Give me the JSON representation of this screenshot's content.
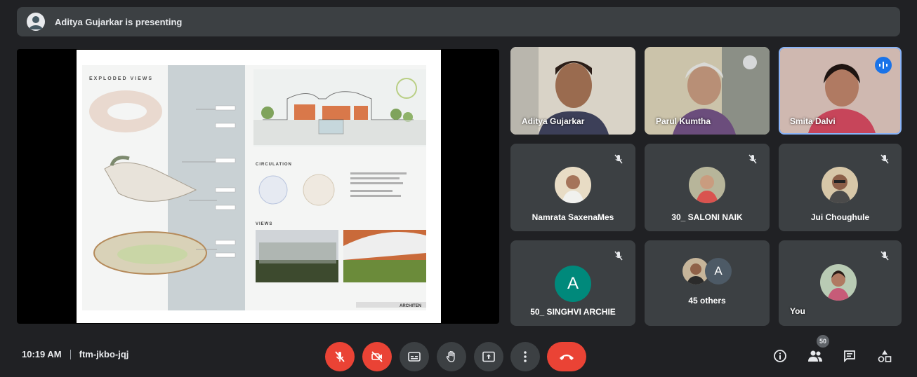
{
  "header": {
    "presenting_text": "Aditya Gujarkar is presenting"
  },
  "slide": {
    "title": "EXPLODED VIEWS",
    "section_circulation": "CIRCULATION",
    "section_views": "VIEWS",
    "brand": "ARCHITEN"
  },
  "participants": {
    "video": [
      {
        "name": "Aditya Gujarkar"
      },
      {
        "name": "Parul Kumtha"
      },
      {
        "name": "Smita Dalvi"
      }
    ],
    "avatar": [
      {
        "name": "Namrata SaxenaMes"
      },
      {
        "name": "30_ SALONI NAIK"
      },
      {
        "name": "Jui Choughule"
      },
      {
        "name": "50_ SINGHVI ARCHIE",
        "initial": "A"
      }
    ],
    "others": {
      "label": "45 others",
      "initial": "A"
    },
    "self": {
      "name": "You"
    }
  },
  "bottom": {
    "time": "10:19 AM",
    "meeting_code": "ftm-jkbo-jqj",
    "people_count": "50"
  },
  "colors": {
    "end_call": "#ea4335",
    "mic_off": "#ea4335",
    "speaking": "#1a73e8",
    "letter_avatar": "#00897b"
  },
  "icons": [
    "mic-off-icon",
    "camera-off-icon",
    "captions-icon",
    "raise-hand-icon",
    "present-icon",
    "more-icon",
    "end-call-icon",
    "info-icon",
    "people-icon",
    "chat-icon",
    "activities-icon"
  ]
}
